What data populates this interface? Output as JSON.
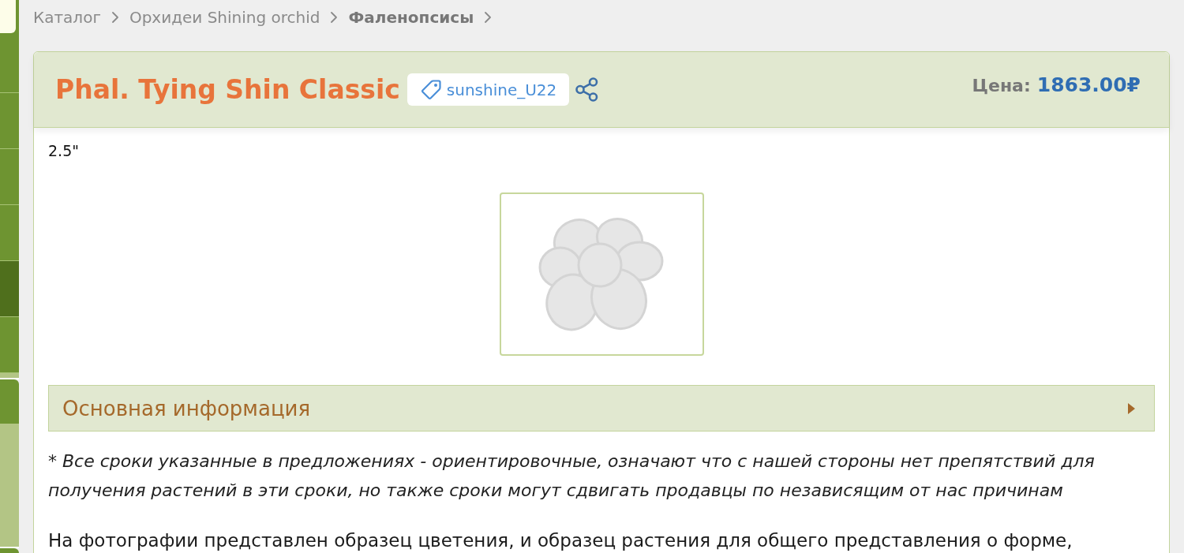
{
  "sidebar": {
    "tiles": [
      {
        "kind": "note"
      },
      {
        "kind": "item",
        "selected": false
      },
      {
        "kind": "item",
        "selected": false
      },
      {
        "kind": "item",
        "selected": false
      },
      {
        "kind": "item",
        "selected": false
      },
      {
        "kind": "item",
        "selected": true
      },
      {
        "kind": "item",
        "selected": false
      },
      {
        "kind": "strip"
      },
      {
        "kind": "subitem",
        "selected": false
      },
      {
        "kind": "panel"
      },
      {
        "kind": "subitem",
        "selected": false
      }
    ]
  },
  "breadcrumbs": [
    {
      "label": "Каталог",
      "current": false
    },
    {
      "label": "Орхидеи Shining orchid",
      "current": false
    },
    {
      "label": "Фаленопсисы",
      "current": true
    }
  ],
  "product": {
    "title": "Phal. Tying Shin Classic",
    "tag": "sunshine_U22",
    "price": {
      "label": "Цена:",
      "value": "1863.00₽"
    },
    "size": "2.5\""
  },
  "section": {
    "title": "Основная информация",
    "expanded": false
  },
  "paragraphs": [
    {
      "kind": "note",
      "text": "* Все сроки указанные в предложениях - ориентировочные, означают что с нашей стороны нет препятствий для получения растений в эти сроки, но также сроки могут сдвигать продавцы по независящим от нас причинам"
    },
    {
      "kind": "plain",
      "text": "На фотографии представлен образец цветения, и образец растения для общего представления о форме,"
    }
  ]
}
